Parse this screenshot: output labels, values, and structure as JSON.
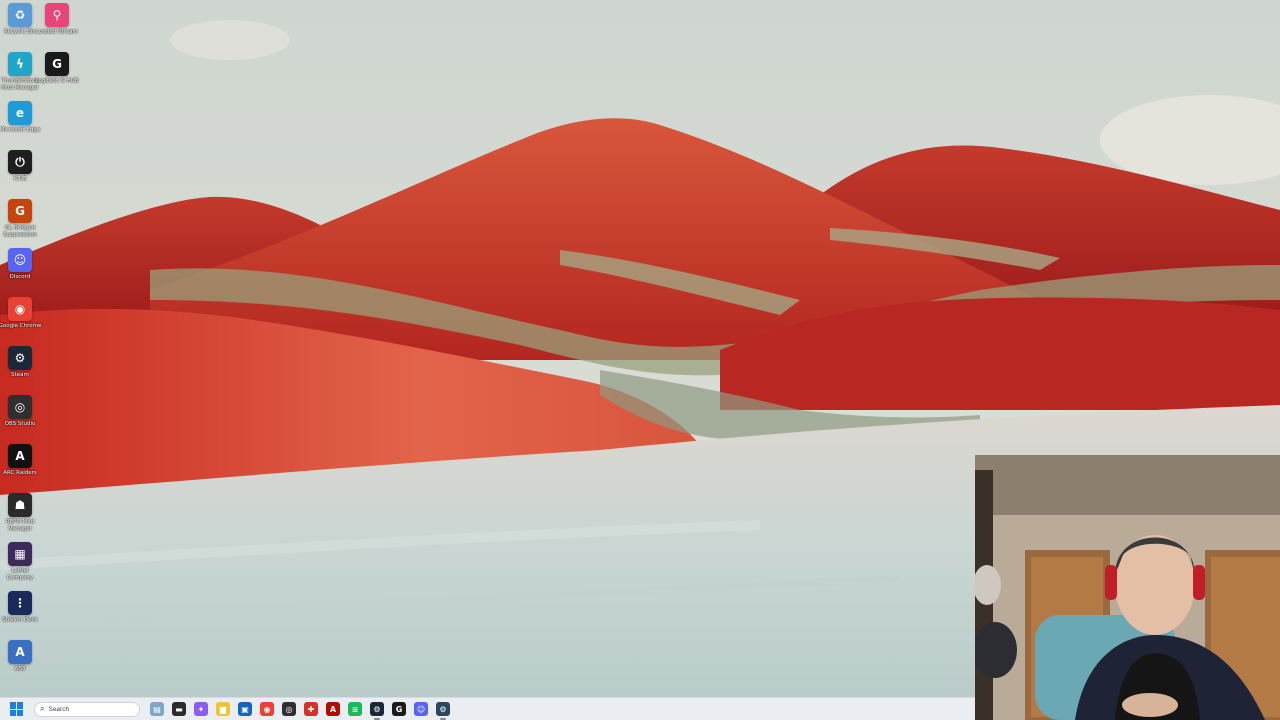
{
  "desktop": {
    "icons": [
      {
        "label": "Recycle Bin",
        "icon": "recycle-bin-icon",
        "color": "#5b9bd5",
        "glyph": "♻"
      },
      {
        "label": "Loaded Stream",
        "icon": "map-pin-icon",
        "color": "#e8457a",
        "glyph": "⚲"
      },
      {
        "label": "Thunderstore Mod Manager",
        "icon": "thunderstore-icon",
        "color": "#21a6c9",
        "glyph": "ϟ"
      },
      {
        "label": "Logitech G HUB",
        "icon": "logitech-g-icon",
        "color": "#1a1a1a",
        "glyph": "G"
      },
      {
        "label": "Microsoft Edge",
        "icon": "edge-icon",
        "color": "#1d9bd8",
        "glyph": "e"
      },
      {
        "label": "iCUE",
        "icon": "icue-icon",
        "color": "#1f1f1f",
        "glyph": "⏻"
      },
      {
        "label": "GL Bridged Suppression",
        "icon": "gl-bridged-icon",
        "color": "#c8440f",
        "glyph": "G"
      },
      {
        "label": "Discord",
        "icon": "discord-icon",
        "color": "#5865f2",
        "glyph": "☺"
      },
      {
        "label": "Google Chrome",
        "icon": "chrome-icon",
        "color": "#e94235",
        "glyph": "◉"
      },
      {
        "label": "Steam",
        "icon": "steam-icon",
        "color": "#1b2838",
        "glyph": "⚙"
      },
      {
        "label": "OBS Studio",
        "icon": "obs-icon",
        "color": "#302e31",
        "glyph": "◎"
      },
      {
        "label": "ARC Raiders",
        "icon": "arc-raiders-icon",
        "color": "#111111",
        "glyph": "A"
      },
      {
        "label": "REPO Mod Manager",
        "icon": "repo-icon",
        "color": "#2b2b2b",
        "glyph": "☗"
      },
      {
        "label": "Lethal Company",
        "icon": "lethal-icon",
        "color": "#3b2a5a",
        "glyph": "▦"
      },
      {
        "label": "Stream Deck",
        "icon": "stream-deck-icon",
        "color": "#1a2a5a",
        "glyph": "⋮"
      },
      {
        "label": "ABS",
        "icon": "abs-icon",
        "color": "#3a6fc2",
        "glyph": "A"
      }
    ]
  },
  "taskbar": {
    "search_placeholder": "Search",
    "apps": [
      {
        "name": "taskbar-widgets",
        "icon": "widgets-icon",
        "color": "#7fa6c7",
        "glyph": "▤"
      },
      {
        "name": "taskbar-file-explorer-dark",
        "icon": "terminal-icon",
        "color": "#2b2b2b",
        "glyph": "▬"
      },
      {
        "name": "taskbar-copilot",
        "icon": "copilot-icon",
        "color": "#8a5cf5",
        "glyph": "✦"
      },
      {
        "name": "taskbar-file-explorer",
        "icon": "folder-icon",
        "color": "#f2c12e",
        "glyph": "▆"
      },
      {
        "name": "taskbar-store",
        "icon": "store-icon",
        "color": "#1565c0",
        "glyph": "▣"
      },
      {
        "name": "taskbar-chrome",
        "icon": "chrome-icon",
        "color": "#e94235",
        "glyph": "◉"
      },
      {
        "name": "taskbar-obs",
        "icon": "obs-icon",
        "color": "#302e31",
        "glyph": "◎"
      },
      {
        "name": "taskbar-racing",
        "icon": "red-app-icon",
        "color": "#d93025",
        "glyph": "✚"
      },
      {
        "name": "taskbar-adobe",
        "icon": "adobe-icon",
        "color": "#b30b00",
        "glyph": "A"
      },
      {
        "name": "taskbar-spotify",
        "icon": "spotify-icon",
        "color": "#1db954",
        "glyph": "≋"
      },
      {
        "name": "taskbar-steam",
        "icon": "steam-icon",
        "color": "#1b2838",
        "glyph": "⚙"
      },
      {
        "name": "taskbar-logitech",
        "icon": "logitech-g-icon",
        "color": "#1a1a1a",
        "glyph": "G"
      },
      {
        "name": "taskbar-discord",
        "icon": "discord-icon",
        "color": "#5865f2",
        "glyph": "☺"
      },
      {
        "name": "taskbar-steam-2",
        "icon": "steam-icon",
        "color": "#2a475e",
        "glyph": "⚙"
      }
    ]
  }
}
